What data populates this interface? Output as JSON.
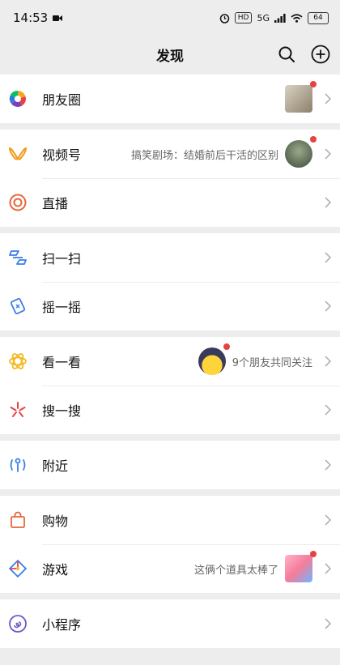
{
  "status": {
    "time": "14:53",
    "hd": "HD",
    "signal": "5G",
    "battery": "64"
  },
  "header": {
    "title": "发现"
  },
  "items": {
    "moments": {
      "label": "朋友圈"
    },
    "channels": {
      "label": "视频号",
      "hint": "搞笑剧场：结婚前后干活的区别"
    },
    "live": {
      "label": "直播"
    },
    "scan": {
      "label": "扫一扫"
    },
    "shake": {
      "label": "摇一摇"
    },
    "topstories": {
      "label": "看一看",
      "hint": "9个朋友共同关注"
    },
    "search": {
      "label": "搜一搜"
    },
    "nearby": {
      "label": "附近"
    },
    "shop": {
      "label": "购物"
    },
    "games": {
      "label": "游戏",
      "hint": "这俩个道具太棒了"
    },
    "miniprograms": {
      "label": "小程序"
    }
  },
  "colors": {
    "badge": "#e64340",
    "background": "#ededed"
  }
}
